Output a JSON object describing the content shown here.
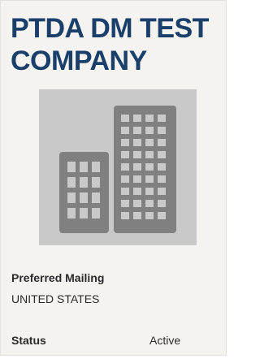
{
  "company": {
    "name": "PTDA DM TEST COMPANY",
    "logo_icon": "building-icon"
  },
  "preferred_mailing": {
    "label": "Preferred Mailing",
    "value": "UNITED STATES"
  },
  "status": {
    "label": "Status",
    "value": "Active"
  },
  "colors": {
    "title": "#1b3f6b",
    "card_background": "#f4f3ef",
    "logo_background": "#c9c9c9",
    "building": "#808080"
  }
}
